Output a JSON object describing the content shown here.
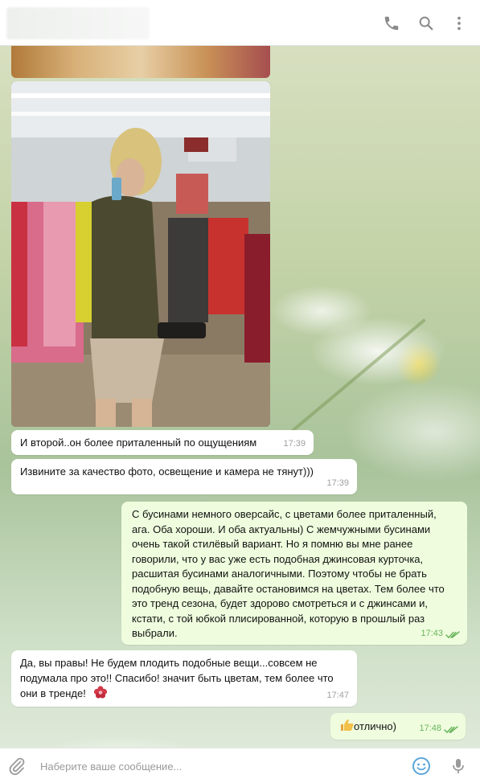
{
  "header": {
    "title": "",
    "icons": [
      "phone-icon",
      "search-icon",
      "more-vert-icon"
    ]
  },
  "messages": [
    {
      "side": "in",
      "text": "И второй..он более приталенный по ощущениям",
      "time": "17:39"
    },
    {
      "side": "in",
      "text": "Извините за качество фото, освещение и камера не тянут)))",
      "time": "17:39"
    },
    {
      "side": "out",
      "lines": [
        "С бусинами немного оверсайс, с цветами более приталенный,",
        "ага. Оба хороши.  И оба актуальны) С жемчужными бусинами",
        "очень такой стилёвый вариант.  Но я помню вы мне ранее",
        "говорили, что у вас уже есть подобная джинсовая курточка,",
        "расшитая бусинами аналогичными. Поэтому чтобы не брать",
        "подобную вещь, давайте остановимся на цветах. Тем более что",
        "это тренд сезона, будет здорово смотреться и с джинсами и,",
        "кстати, с той юбкой плисированной, которую в прошлый раз",
        "выбрали."
      ],
      "time": "17:43",
      "status": "read"
    },
    {
      "side": "in",
      "lines": [
        "Да, вы правы! Не будем плодить подобные вещи...совсем не",
        "подумала про это!! Спасибо! значит быть цветам, тем более что",
        "они в тренде!"
      ],
      "emoji": "flower-emoji",
      "time": "17:47"
    },
    {
      "side": "out",
      "text": "отлично)",
      "emoji": "thumbs-up-emoji",
      "time": "17:48",
      "status": "read"
    }
  ],
  "input": {
    "placeholder": "Наберите ваше сообщение..."
  },
  "colors": {
    "incoming_bubble": "#ffffff",
    "outgoing_bubble": "#effdde",
    "time_outgoing": "#6cb45e",
    "icon_gray": "#8a8a8a",
    "emoji_blue": "#5aa5d9"
  }
}
